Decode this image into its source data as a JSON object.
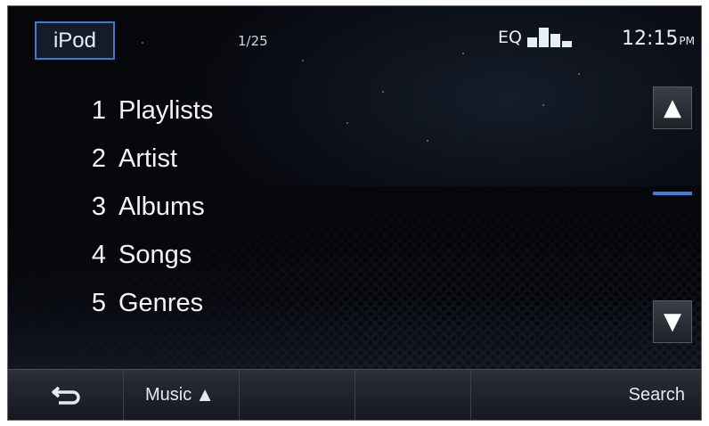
{
  "header": {
    "source_label": "iPod",
    "track_counter": "1/25",
    "eq_label": "EQ",
    "eq_icon": "eq-bars-icon",
    "clock_time": "12:15",
    "clock_ampm": "PM"
  },
  "menu": {
    "items": [
      {
        "num": "1",
        "label": "Playlists"
      },
      {
        "num": "2",
        "label": "Artist"
      },
      {
        "num": "3",
        "label": "Albums"
      },
      {
        "num": "4",
        "label": "Songs"
      },
      {
        "num": "5",
        "label": "Genres"
      }
    ]
  },
  "scroll": {
    "up_glyph": "▲",
    "down_glyph": "▼",
    "accent_color": "#3a7fd8"
  },
  "bottom_bar": {
    "back_glyph": "⮌",
    "music_label": "Music",
    "music_glyph": "▲",
    "search_label": "Search"
  },
  "colors": {
    "source_border": "#3f79c9",
    "text": "#f2f4f8"
  }
}
